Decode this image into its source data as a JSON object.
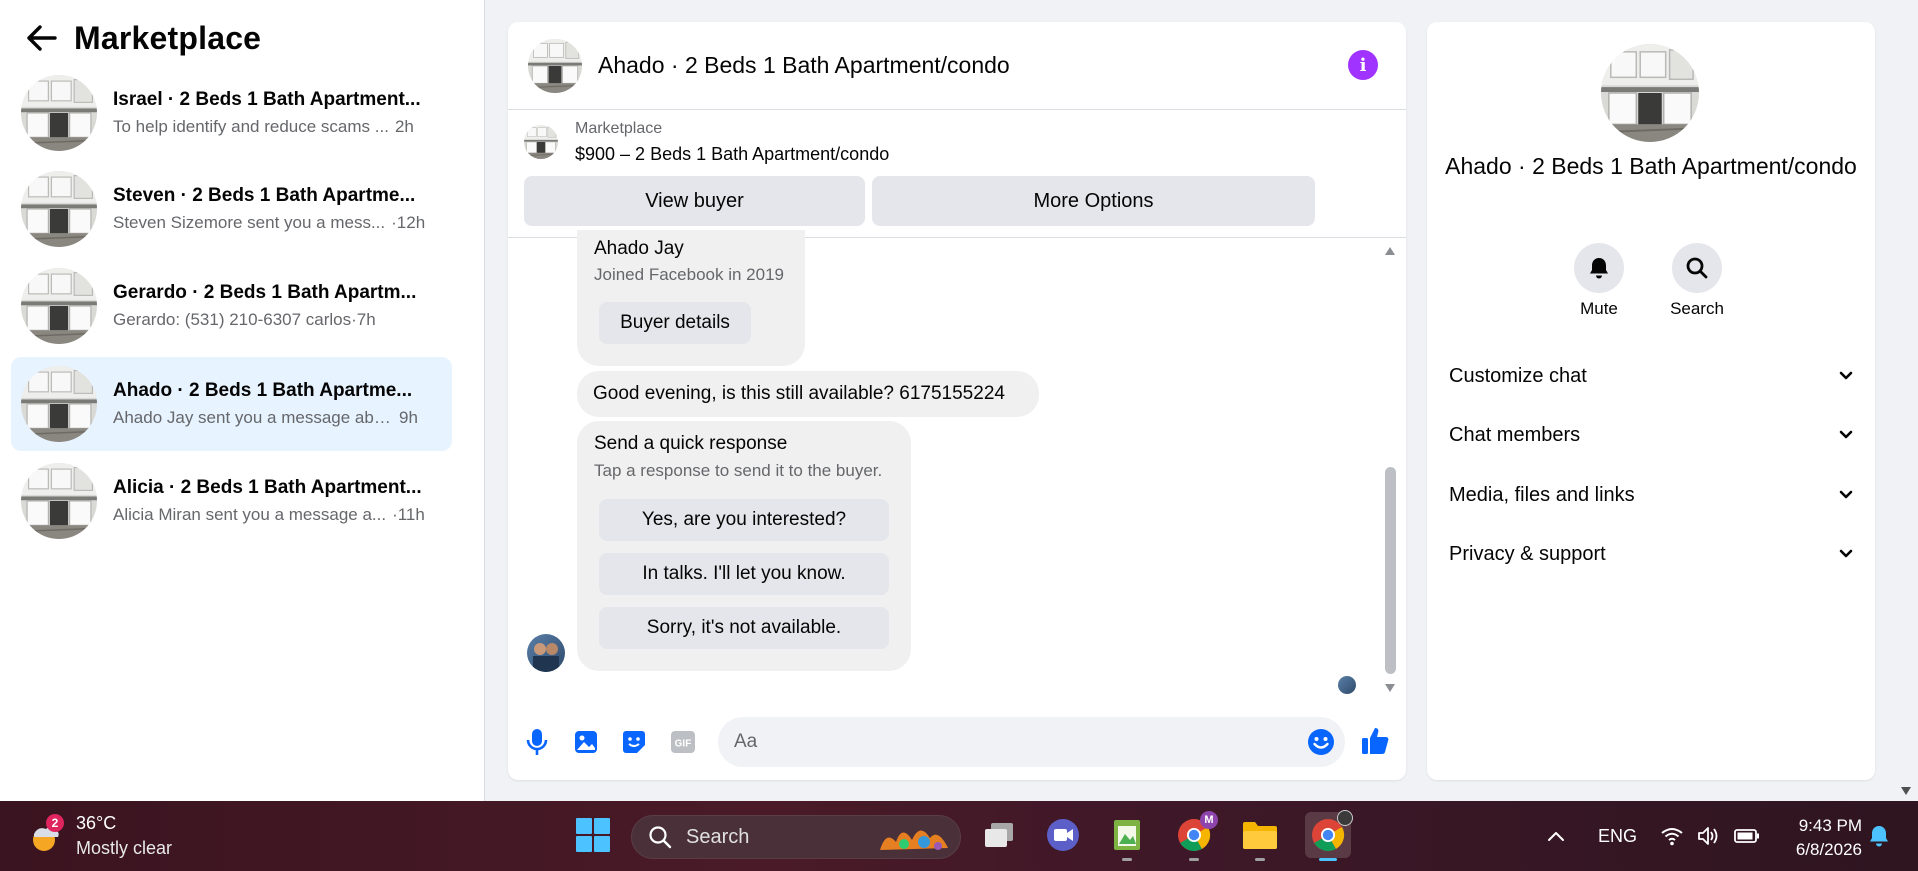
{
  "sidebar": {
    "title": "Marketplace",
    "conversations": [
      {
        "name": "Israel · 2 Beds 1 Bath Apartment...",
        "preview": "To help identify and reduce scams ...",
        "time": "2h"
      },
      {
        "name": "Steven · 2 Beds 1 Bath Apartme...",
        "preview": "Steven Sizemore sent you a mess...",
        "time": "·12h"
      },
      {
        "name": "Gerardo · 2 Beds 1 Bath Apartm...",
        "preview": "Gerardo: (531) 210-6307 carlos",
        "time": "·7h"
      },
      {
        "name": "Ahado · 2 Beds 1 Bath Apartme...",
        "preview": "Ahado Jay sent you a message abo...",
        "time": "9h"
      },
      {
        "name": "Alicia · 2 Beds 1 Bath Apartment...",
        "preview": "Alicia Miran sent you a message a...",
        "time": "·11h"
      }
    ]
  },
  "chat": {
    "title": "Ahado · 2 Beds 1 Bath Apartment/condo",
    "listing_source": "Marketplace",
    "listing_title": "$900 – 2 Beds 1 Bath Apartment/condo",
    "view_buyer_label": "View buyer",
    "more_options_label": "More Options",
    "buyer_name": "Ahado Jay",
    "buyer_joined": "Joined Facebook in 2019",
    "buyer_details_label": "Buyer details",
    "incoming_message": "Good evening, is this still available? 6175155224",
    "quick_response_title": "Send a quick response",
    "quick_response_hint": "Tap a response to send it to the buyer.",
    "quick_responses": [
      "Yes, are you interested?",
      "In talks. I'll let you know.",
      "Sorry, it's not available."
    ],
    "input_placeholder": "Aa"
  },
  "info_panel": {
    "name": "Ahado · 2 Beds 1 Bath Apartment/condo",
    "mute_label": "Mute",
    "search_label": "Search",
    "sections": [
      "Customize chat",
      "Chat members",
      "Media, files and links",
      "Privacy & support"
    ]
  },
  "taskbar": {
    "weather_temp": "36°C",
    "weather_condition": "Mostly clear",
    "weather_badge": "2",
    "search_label": "Search",
    "chrome_badge": "M",
    "language": "ENG",
    "time": "9:43 PM",
    "date": "6/8/2026"
  },
  "colors": {
    "accent": "#0866ff",
    "info_button": "#a033ff",
    "active_conversation": "#e7f3ff"
  }
}
